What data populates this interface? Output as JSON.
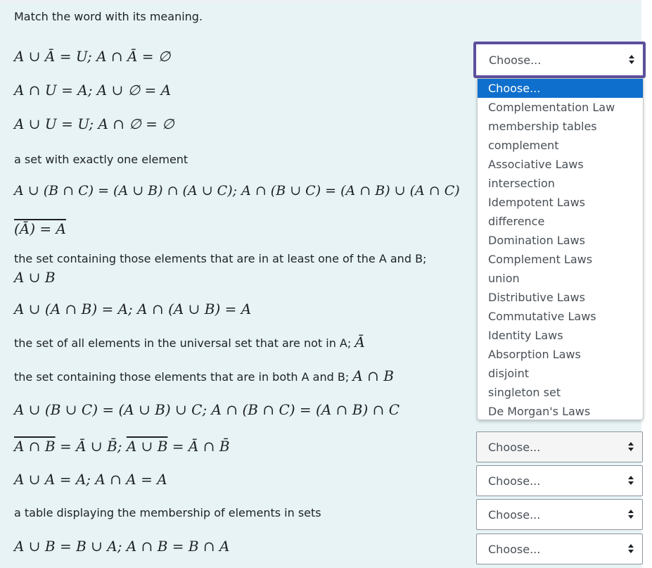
{
  "question": {
    "prompt": "Match the word with its meaning."
  },
  "items": [
    {
      "type": "math",
      "text": "A ∪ Ā = U; A ∩ Ā = ∅"
    },
    {
      "type": "math",
      "text": "A ∩ U = A; A ∪ ∅ = A"
    },
    {
      "type": "math",
      "text": "A ∪ U = U; A ∩ ∅ = ∅"
    },
    {
      "type": "text",
      "text": "a set with exactly one element"
    },
    {
      "type": "math",
      "text": "A ∪ (B ∩ C) = (A ∪ B) ∩ (A ∪ C); A ∩ (B ∪ C) = (A ∩ B) ∪ (A ∩ C)"
    },
    {
      "type": "math",
      "text": "(Ā) = A"
    },
    {
      "type": "text",
      "text": "the set containing those elements that are in at least one of the A and B;"
    },
    {
      "type": "math",
      "text": "A ∪ B"
    },
    {
      "type": "math",
      "text": "A ∪ (A ∩ B) = A; A ∩ (A ∪ B) = A"
    },
    {
      "type": "text",
      "text": "the set of all elements in the universal set that are not in A;",
      "math": "Ā"
    },
    {
      "type": "text",
      "text": "the set containing those elements that are in both A and B;",
      "math": "A ∩ B"
    },
    {
      "type": "math",
      "text": "A ∪ (B ∪ C) = (A ∪ B) ∪ C; A ∩ (B ∩ C) = (A ∩ B) ∩ C"
    },
    {
      "type": "math",
      "parts": [
        "A ∩ B",
        " = Ā ∪ B̄; ",
        "A ∪ B",
        " = Ā ∩ B̄"
      ]
    },
    {
      "type": "math",
      "text": "A ∪ A = A; A ∩ A = A"
    },
    {
      "type": "text",
      "text": "a table displaying the membership of elements in sets"
    },
    {
      "type": "math",
      "text": "A ∪ B = B ∪ A; A ∩ B = B ∩ A"
    }
  ],
  "selects": {
    "focused_value": "Choose...",
    "values": [
      "Choose...",
      "Choose...",
      "Choose...",
      "Choose..."
    ]
  },
  "dropdown": {
    "options": [
      "Choose...",
      "Complementation Law",
      "membership tables",
      "complement",
      "Associative Laws",
      "intersection",
      "Idempotent Laws",
      "difference",
      "Domination Laws",
      "Complement Laws",
      "union",
      "Distributive Laws",
      "Commutative Laws",
      "Identity Laws",
      "Absorption Laws",
      "disjoint",
      "singleton set",
      "De Morgan's Laws"
    ],
    "highlighted_index": 0
  },
  "colors": {
    "panel_bg": "#e7f3f5",
    "focus_ring": "#5d4f9c",
    "highlight": "#0f6fcc"
  }
}
